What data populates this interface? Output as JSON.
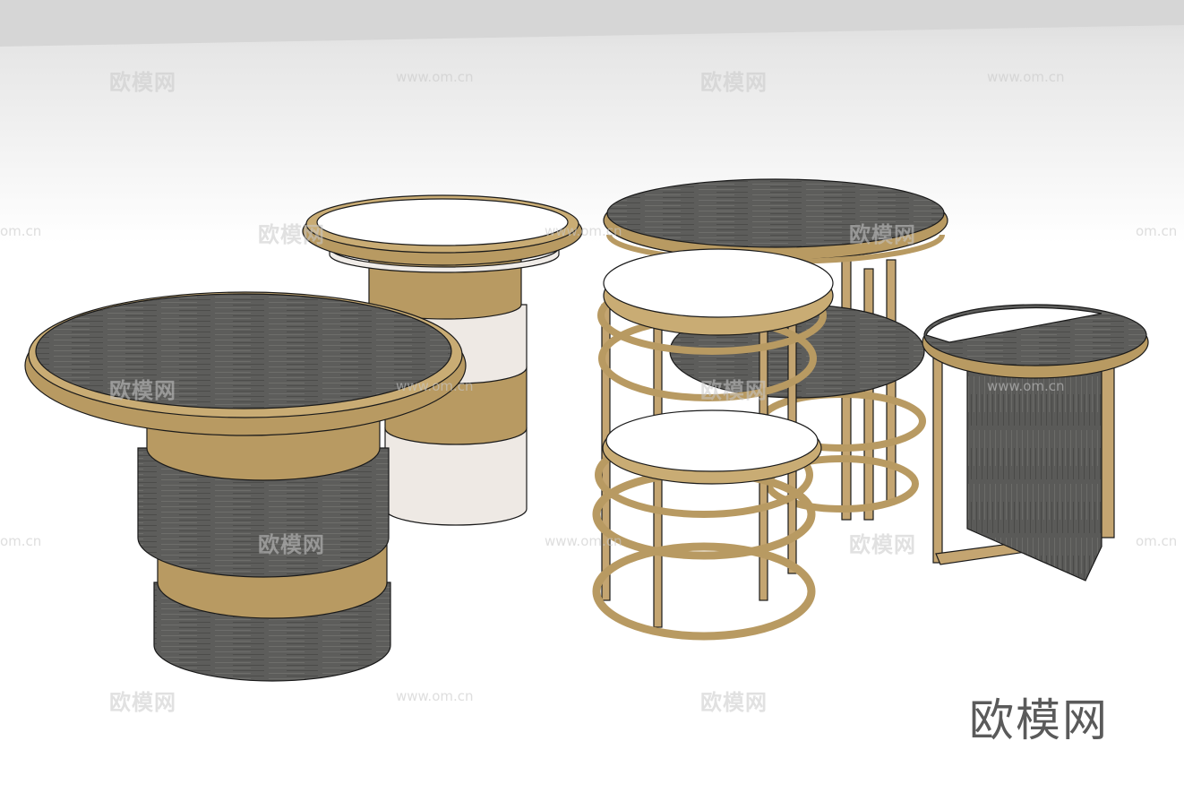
{
  "watermark": {
    "brand": "欧模网",
    "url": "www.om.cn",
    "url_clipped": "om.cn"
  },
  "logo_text": "欧模网",
  "colors": {
    "wood_dark": "#5b5b59",
    "brass": "#b89a62",
    "white_top": "#ffffff",
    "outline": "#1a1a1a"
  }
}
